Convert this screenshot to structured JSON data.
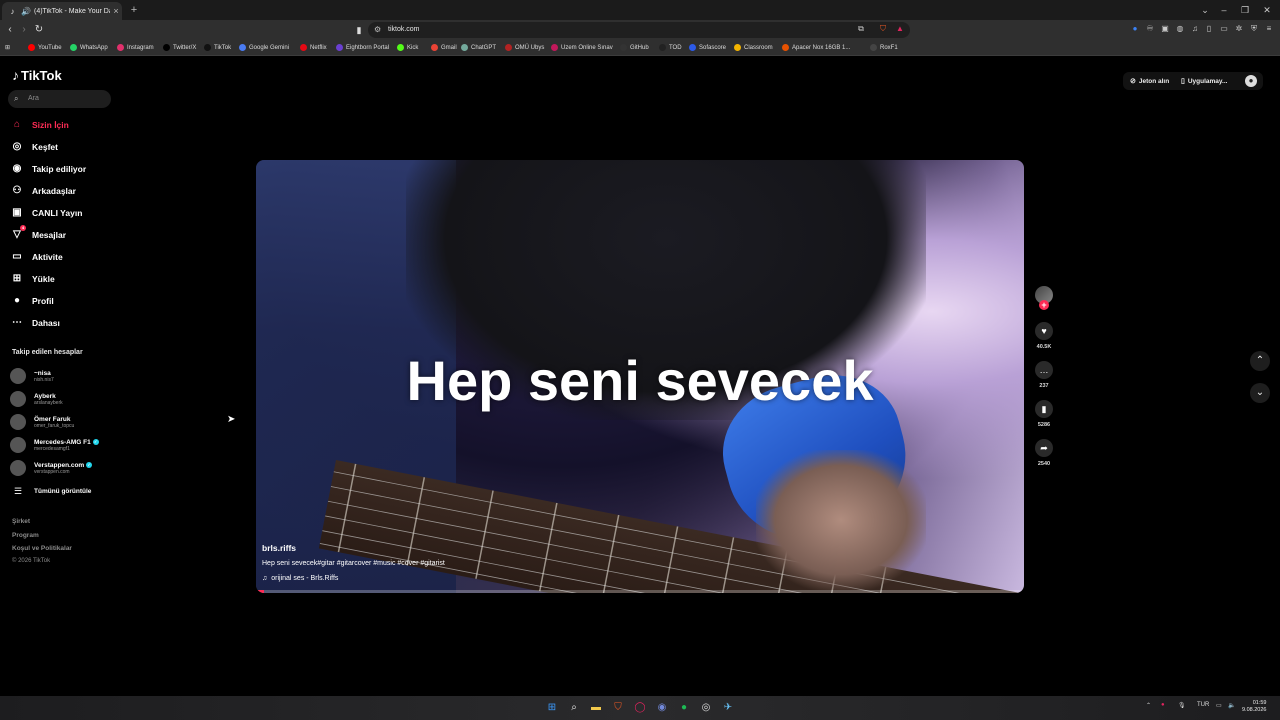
{
  "browser": {
    "tab_title": "(4)TikTok - Make Your Day",
    "url": "tiktok.com",
    "bookmarks": [
      {
        "label": "YouTube",
        "color": "#ff0000"
      },
      {
        "label": "WhatsApp",
        "color": "#25d366"
      },
      {
        "label": "Instagram",
        "color": "#e1306c"
      },
      {
        "label": "Twitter/X",
        "color": "#000000"
      },
      {
        "label": "TikTok",
        "color": "#111111"
      },
      {
        "label": "Google Gemini",
        "color": "#4a7cf3"
      },
      {
        "label": "Netflix",
        "color": "#e50914"
      },
      {
        "label": "Eightborn Portal",
        "color": "#6a3fd1"
      },
      {
        "label": "Kick",
        "color": "#53fc18"
      },
      {
        "label": "Gmail",
        "color": "#ea4335"
      },
      {
        "label": "ChatGPT",
        "color": "#74aa9c"
      },
      {
        "label": "OMÜ Ubys",
        "color": "#b22222"
      },
      {
        "label": "Uzem Online Sınav",
        "color": "#c2185b"
      },
      {
        "label": "GitHub",
        "color": "#333333"
      },
      {
        "label": "TOD",
        "color": "#222222"
      },
      {
        "label": "Sofascore",
        "color": "#2c5ae9"
      },
      {
        "label": "Classroom",
        "color": "#f4b400"
      },
      {
        "label": "Apacer Nox 16GB 1...",
        "color": "#e65100"
      },
      {
        "label": "RoxF1",
        "color": "#444444"
      }
    ]
  },
  "tiktok": {
    "logo": "TikTok",
    "search_placeholder": "Ara",
    "nav": [
      {
        "label": "Sizin İçin",
        "icon": "home-icon",
        "active": true
      },
      {
        "label": "Keşfet",
        "icon": "compass-icon"
      },
      {
        "label": "Takip ediliyor",
        "icon": "following-avatar-icon"
      },
      {
        "label": "Arkadaşlar",
        "icon": "friends-icon"
      },
      {
        "label": "CANLI Yayın",
        "icon": "live-icon"
      },
      {
        "label": "Mesajlar",
        "icon": "messages-icon",
        "badge": "4"
      },
      {
        "label": "Aktivite",
        "icon": "activity-icon"
      },
      {
        "label": "Yükle",
        "icon": "upload-icon"
      },
      {
        "label": "Profil",
        "icon": "profile-icon"
      },
      {
        "label": "Dahası",
        "icon": "more-icon"
      }
    ],
    "following_title": "Takip edilen hesaplar",
    "following": [
      {
        "name": "~nisa",
        "username": "nish.nis7",
        "verified": false
      },
      {
        "name": "Ayberk",
        "username": "arslanayberk",
        "verified": false
      },
      {
        "name": "Ömer Faruk",
        "username": "omer_faruk_topcu",
        "verified": false
      },
      {
        "name": "Mercedes-AMG F1",
        "username": "mercedesamgf1",
        "verified": true
      },
      {
        "name": "Verstappen.com",
        "username": "verstappen.com",
        "verified": true
      }
    ],
    "see_all": "Tümünü görüntüle",
    "footer": [
      "Şirket",
      "Program",
      "Koşul ve Politikalar",
      "© 2026 TikTok"
    ],
    "top_right": {
      "coins": "Jeton alın",
      "app": "Uygulamay..."
    },
    "video": {
      "caption": "Hep seni sevecek",
      "author": "brls.riffs",
      "description": "Hep seni sevecek#gitar #gitarcover #music #cover #gitarist",
      "music": "orijinal ses - Brls.Riffs",
      "progress": 0.01
    },
    "actions": {
      "likes": "40.5K",
      "comments": "237",
      "saves": "5286",
      "shares": "2540"
    }
  },
  "taskbar": {
    "language": "TUR",
    "time": "01:59",
    "date": "9.08.2026"
  }
}
